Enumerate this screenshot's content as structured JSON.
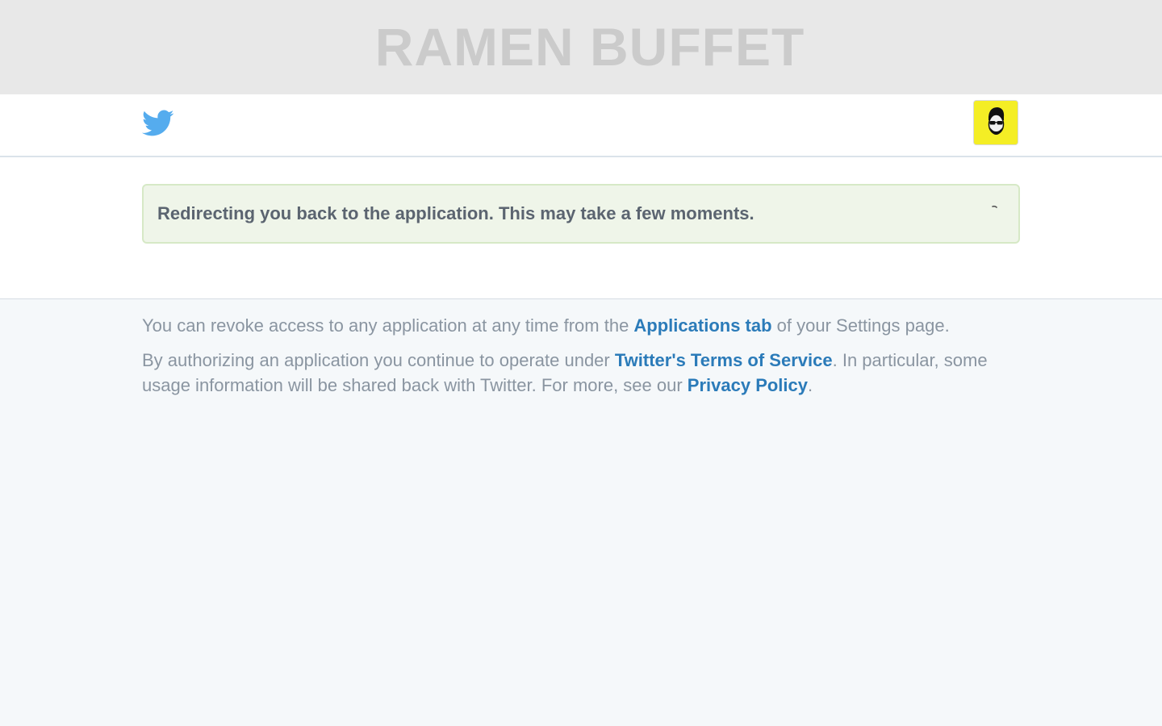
{
  "banner": {
    "title": "RAMEN BUFFET"
  },
  "header": {
    "logo_icon": "twitter-bird-icon",
    "avatar_icon": "user-avatar",
    "avatar_color": "#f4ee25"
  },
  "message": {
    "text": "Redirecting you back to the application. This may take a few moments.",
    "spinner_icon": "loading-spinner-icon"
  },
  "footer": {
    "line1_pre": "You can revoke access to any application at any time from the ",
    "line1_link": "Applications tab",
    "line1_post": " of your Settings page.",
    "line2_pre": "By authorizing an application you continue to operate under ",
    "line2_link": "Twitter's Terms of Service",
    "line2_mid": ". In particular, some usage information will be shared back with Twitter. For more, see our ",
    "line2_link2": "Privacy Policy",
    "line2_post": "."
  },
  "colors": {
    "link": "#2b7bb9",
    "twitter_blue": "#55acee",
    "banner_bg": "#e8e8e8",
    "message_bg": "#eff5e9",
    "message_border": "#d6e9c6"
  }
}
